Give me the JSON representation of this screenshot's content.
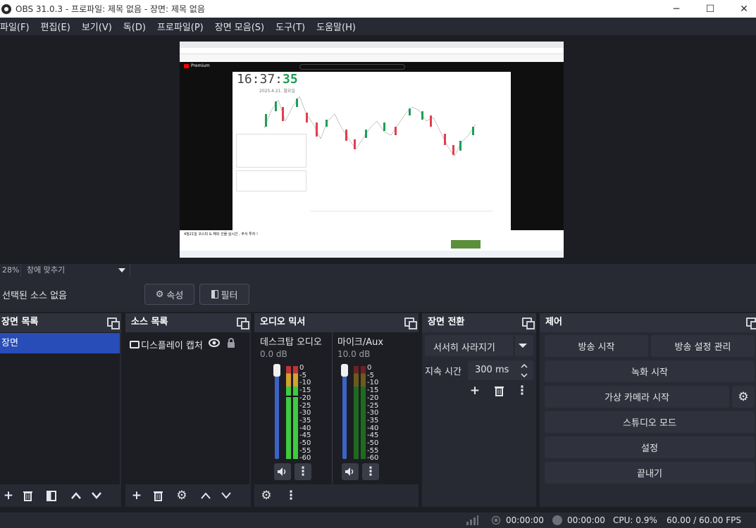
{
  "window": {
    "title": "OBS 31.0.3 - 프로파일: 제목 없음 - 장면: 제목 없음",
    "minimize_glyph": "─",
    "maximize_glyph": "☐",
    "close_glyph": "✕"
  },
  "menu": [
    "파일(F)",
    "편집(E)",
    "보기(V)",
    "독(D)",
    "프로파일(P)",
    "장면 모음(S)",
    "도구(T)",
    "도움말(H)"
  ],
  "preview": {
    "clock_hm": "16:37:",
    "clock_s": "35",
    "clock_date": "2025.4.21. 월요일",
    "video_title": "4월21일 코스피 & 해외 선물 실시간 , 주식 투자 !",
    "channel_badge": "Premium"
  },
  "zoom": {
    "value": "28%",
    "fit_label": "창에 맞추기"
  },
  "source_toolbar": {
    "no_selection": "선택된 소스 없음",
    "properties_label": "속성",
    "filters_label": "필터"
  },
  "scenes": {
    "title": "장면 목록",
    "items": [
      "장면"
    ]
  },
  "sources": {
    "title": "소스 목록",
    "items": [
      "디스플레이 캡처"
    ]
  },
  "mixer": {
    "title": "오디오 믹서",
    "channels": [
      {
        "name": "데스크탑 오디오",
        "level": "0.0 dB"
      },
      {
        "name": "마이크/Aux",
        "level": "10.0 dB"
      }
    ],
    "scale": [
      "0",
      "-5",
      "-10",
      "-15",
      "-20",
      "-25",
      "-30",
      "-35",
      "-40",
      "-45",
      "-50",
      "-55",
      "-60"
    ]
  },
  "transitions": {
    "title": "장면 전환",
    "selected": "서서히 사라지기",
    "duration_label": "지속 시간",
    "duration_value": "300 ms"
  },
  "controls": {
    "title": "제어",
    "start_streaming": "방송 시작",
    "stream_settings": "방송 설정 관리",
    "start_recording": "녹화 시작",
    "start_virtual_cam": "가상 카메라 시작",
    "studio_mode": "스튜디오 모드",
    "settings": "설정",
    "exit": "끝내기"
  },
  "status": {
    "stream_time": "00:00:00",
    "record_time": "00:00:00",
    "cpu": "CPU: 0.9%",
    "fps": "60.00 / 60.00 FPS"
  }
}
